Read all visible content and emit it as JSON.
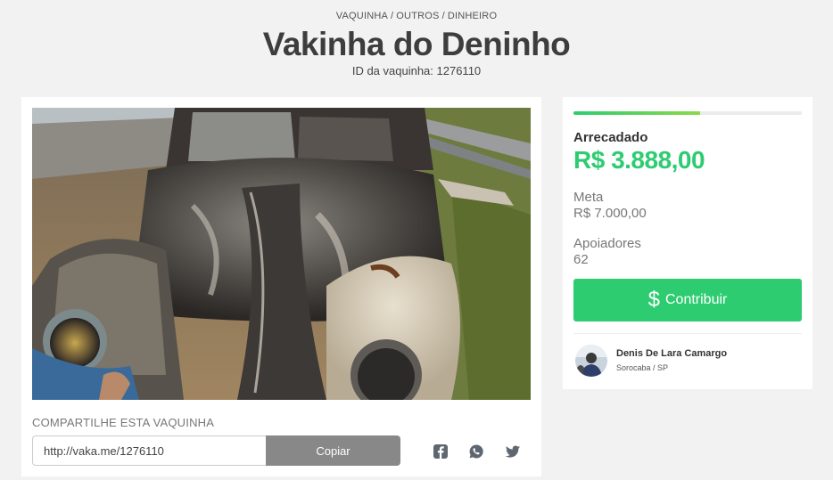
{
  "breadcrumb": [
    "VAQUINHA",
    "OUTROS",
    "DINHEIRO"
  ],
  "breadcrumb_sep": "/",
  "title": "Vakinha do Deninho",
  "vaquinha_id": "ID da vaquinha: 1276110",
  "share": {
    "title": "COMPARTILHE ESTA VAQUINHA",
    "link": "http://vaka.me/1276110",
    "copy_label": "Copiar",
    "icons": [
      "facebook-icon",
      "whatsapp-icon",
      "twitter-icon"
    ]
  },
  "stats": {
    "progress_fraction": 0.555,
    "raised_label": "Arrecadado",
    "raised_value": "R$ 3.888,00",
    "goal_label": "Meta",
    "goal_value": "R$ 7.000,00",
    "supporters_label": "Apoiadores",
    "supporters_value": "62"
  },
  "contribute": {
    "symbol": "$",
    "label": "Contribuir"
  },
  "owner": {
    "name": "Denis De Lara Camargo",
    "location": "Sorocaba / SP"
  },
  "colors": {
    "accent": "#2ecc71",
    "copy_button": "#888888",
    "background": "#f2f2f2"
  }
}
